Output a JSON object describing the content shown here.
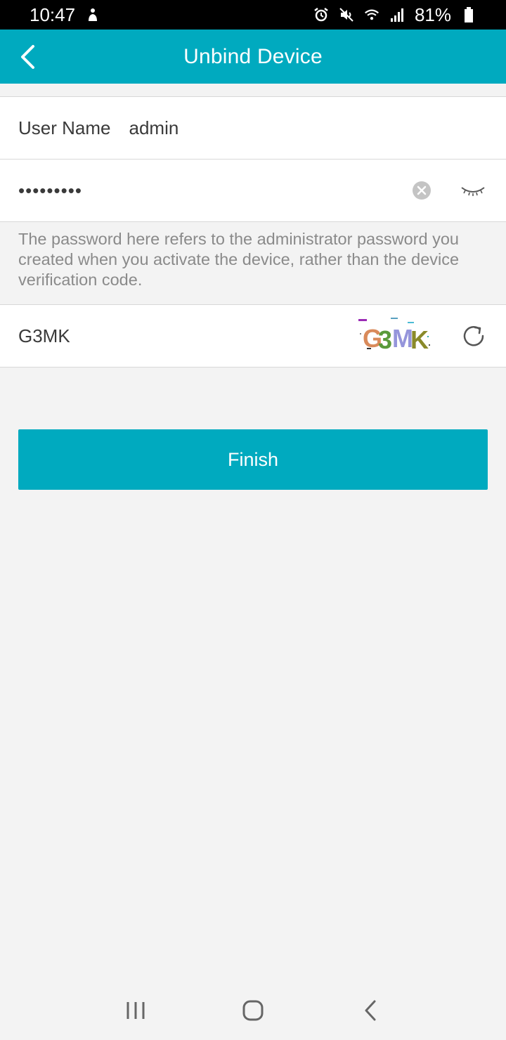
{
  "status_bar": {
    "time": "10:47",
    "battery": "81%",
    "icons": [
      "alarm-icon",
      "mute-icon",
      "wifi-icon",
      "signal-icon",
      "battery-icon"
    ]
  },
  "app_bar": {
    "title": "Unbind Device",
    "back_icon": "chevron-left-icon"
  },
  "form": {
    "user_name_label": "User Name",
    "user_name_value": "admin",
    "password_masked": "•••••••••",
    "hint": "The password here refers to the administrator password you created when you activate the device, rather than the device verification code.",
    "verification_code_value": "G3MK",
    "captcha_text": "G3MK"
  },
  "actions": {
    "finish_label": "Finish"
  },
  "colors": {
    "accent": "#00aabf",
    "background": "#f3f3f3",
    "hint_text": "#8a8a8a"
  }
}
